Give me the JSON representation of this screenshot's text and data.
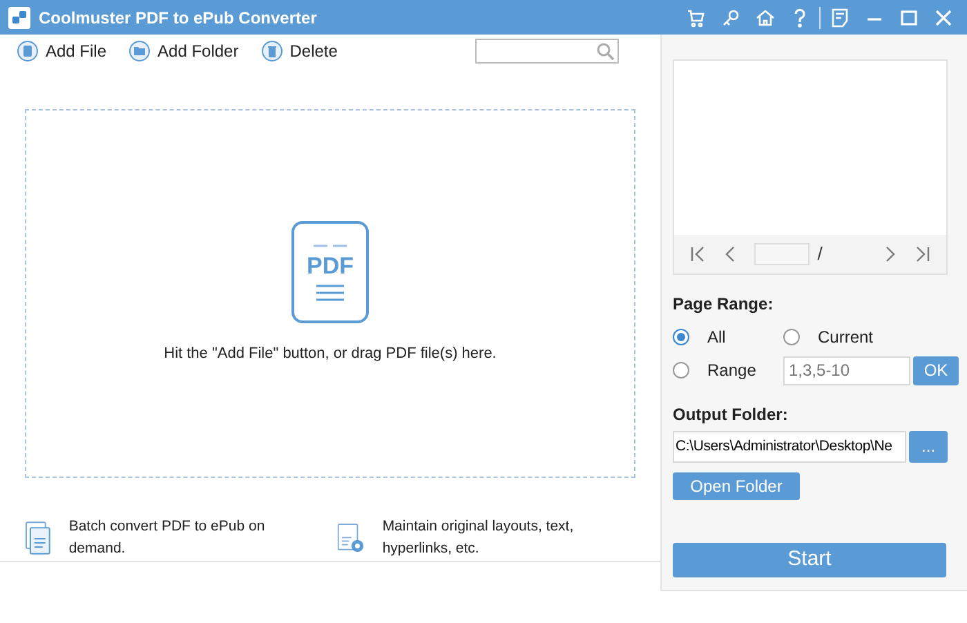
{
  "window": {
    "title": "Coolmuster PDF to ePub Converter"
  },
  "toolbar": {
    "buttons": [
      {
        "label": "Add File",
        "kind": "file"
      },
      {
        "label": "Add Folder",
        "kind": "folder"
      },
      {
        "label": "Delete",
        "kind": "delete"
      }
    ]
  },
  "drop_zone": {
    "icon_text": "PDF",
    "hint": "Hit the \"Add File\" button, or drag PDF file(s) here."
  },
  "features": [
    {
      "text": "Batch convert PDF to ePub on demand.",
      "kind": "batch"
    },
    {
      "text": "Maintain original layouts, text, hyperlinks, etc.",
      "kind": "layout"
    }
  ],
  "preview": {
    "page_separator": "/"
  },
  "page_range": {
    "label": "Page Range:",
    "options": [
      {
        "label": "All",
        "selected": true
      },
      {
        "label": "Current",
        "selected": false
      },
      {
        "label": "Range",
        "selected": false
      }
    ],
    "range_placeholder": "1,3,5-10",
    "ok": "OK"
  },
  "output": {
    "label": "Output Folder:",
    "path": "C:\\Users\\Administrator\\Desktop\\Ne",
    "browse": "...",
    "open_folder": "Open Folder"
  },
  "start": "Start"
}
